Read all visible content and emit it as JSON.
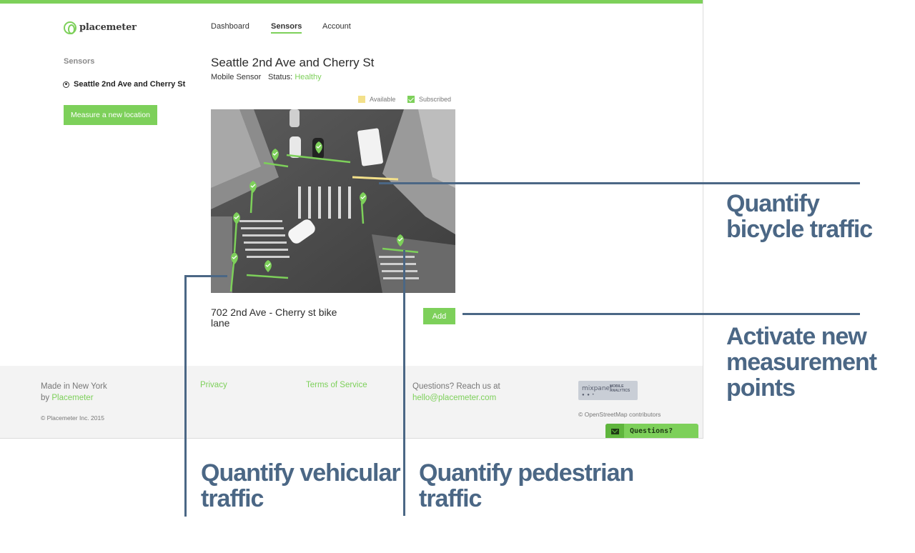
{
  "app": {
    "brand": "placemeter",
    "nav": [
      "Dashboard",
      "Sensors",
      "Account"
    ],
    "active_nav": "Sensors"
  },
  "sidebar": {
    "heading": "Sensors",
    "items": [
      {
        "label": "Seattle 2nd Ave and Cherry St",
        "icon": "target-icon"
      }
    ],
    "measure_button": "Measure a new location"
  },
  "sensor": {
    "title": "Seattle 2nd Ave and Cherry St",
    "type": "Mobile Sensor",
    "status_label": "Status:",
    "status_value": "Healthy"
  },
  "legend": {
    "available": "Available",
    "subscribed": "Subscribed"
  },
  "camera": {
    "description_icon": "street-camera-feed"
  },
  "location": {
    "name": "702 2nd Ave - Cherry st bike lane",
    "add_button": "Add"
  },
  "footer": {
    "made_line1": "Made in New York",
    "made_line2_prefix": "by",
    "made_link": "Placemeter",
    "copyright": "© Placemeter Inc. 2015",
    "privacy": "Privacy",
    "terms": "Terms of Service",
    "questions_line1": "Questions? Reach us at",
    "questions_email": "hello@placemeter.com",
    "mixpanel_name": "mixpanel",
    "mixpanel_tag1": "MOBILE",
    "mixpanel_tag2": "ANALYTICS",
    "osm": "© OpenStreetMap contributors",
    "questions_tab": "Questions?"
  },
  "callouts": {
    "bicycle_line1": "Quantify",
    "bicycle_line2": "bicycle traffic",
    "activate_line1": "Activate new",
    "activate_line2": "measurement",
    "activate_line3": "points",
    "vehicular_line1": "Quantify vehicular",
    "vehicular_line2": "traffic",
    "pedestrian_line1": "Quantify pedestrian",
    "pedestrian_line2": "traffic"
  },
  "colors": {
    "accent": "#7dd05a",
    "callout": "#4b6785",
    "available": "#f3e08a"
  }
}
